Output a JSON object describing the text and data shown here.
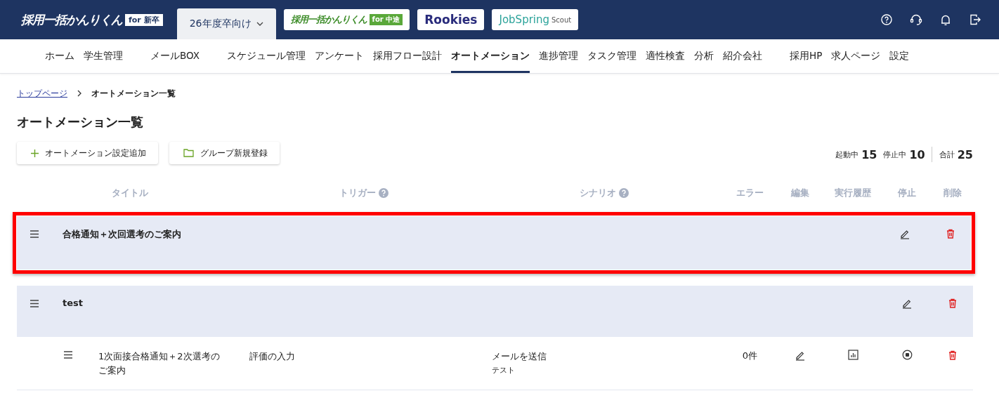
{
  "header": {
    "logo": {
      "text": "採用一括かんりくん",
      "badge": "for 新卒"
    },
    "year_tab": {
      "label": "26年度卒向け"
    },
    "product_links": [
      {
        "kind": "logo",
        "text": "採用一括かんりくん",
        "badge": "for 中途"
      },
      {
        "kind": "wordmark",
        "text": "Rookies"
      },
      {
        "kind": "wordmark_sub",
        "text": "JobSpring",
        "sub": "Scout"
      }
    ]
  },
  "nav": [
    {
      "label": "ホーム",
      "selected": false
    },
    {
      "label": "学生管理",
      "selected": false
    },
    {
      "label": "メールBOX",
      "selected": false
    },
    {
      "label": "スケジュール管理",
      "selected": false
    },
    {
      "label": "アンケート",
      "selected": false
    },
    {
      "label": "採用フロー設計",
      "selected": false
    },
    {
      "label": "オートメーション",
      "selected": true
    },
    {
      "label": "進捗管理",
      "selected": false
    },
    {
      "label": "タスク管理",
      "selected": false
    },
    {
      "label": "適性検査",
      "selected": false
    },
    {
      "label": "分析",
      "selected": false
    },
    {
      "label": "紹介会社",
      "selected": false
    },
    {
      "label": "採用HP",
      "selected": false
    },
    {
      "label": "求人ページ",
      "selected": false
    },
    {
      "label": "設定",
      "selected": false
    }
  ],
  "breadcrumb": [
    {
      "kind": "link",
      "label": "トップページ"
    },
    {
      "kind": "current",
      "label": "オートメーション一覧"
    }
  ],
  "page_title": "オートメーション一覧",
  "actions": [
    {
      "kind": "add",
      "label": "オートメーション設定追加"
    },
    {
      "kind": "folder",
      "label": "グループ新規登録"
    }
  ],
  "stats": [
    {
      "kind": "count",
      "label": "起動中",
      "value": "15"
    },
    {
      "kind": "count",
      "label": "停止中",
      "value": "10"
    },
    {
      "kind": "total",
      "label": "合計",
      "value": "25"
    }
  ],
  "table": {
    "columns": [
      {
        "label": "タイトル",
        "help": false
      },
      {
        "label": "トリガー",
        "help": true
      },
      {
        "label": "シナリオ",
        "help": true
      },
      {
        "label": "エラー",
        "help": false
      },
      {
        "label": "編集",
        "help": false
      },
      {
        "label": "実行履歴",
        "help": false
      },
      {
        "label": "停止",
        "help": false
      },
      {
        "label": "削除",
        "help": false
      }
    ],
    "groups": [
      {
        "title": "合格通知＋次回選考のご案内",
        "highlighted": true
      },
      {
        "title": "test",
        "highlighted": false,
        "rows": [
          {
            "title": "1次面接合格通知＋2次選考のご案内",
            "trigger": "評価の入力",
            "scenario": "メールを送信",
            "scenario_detail": "テスト",
            "errors": "0件"
          }
        ]
      }
    ]
  }
}
